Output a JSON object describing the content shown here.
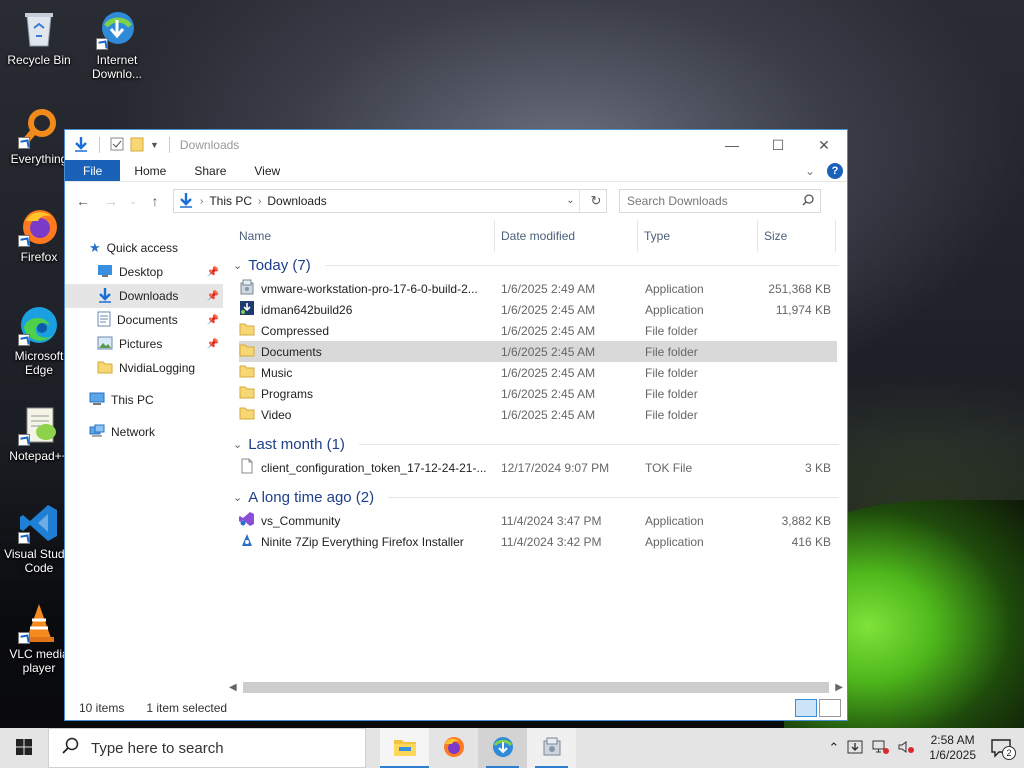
{
  "desktop": {
    "icons": [
      {
        "label": "Recycle Bin"
      },
      {
        "label": "Internet Downlo..."
      },
      {
        "label": "Everything"
      },
      {
        "label": "Firefox"
      },
      {
        "label": "Microsoft Edge"
      },
      {
        "label": "Notepad++"
      },
      {
        "label": "Visual Studio Code"
      },
      {
        "label": "VLC media player"
      }
    ]
  },
  "window": {
    "title": "Downloads",
    "ribbon_tabs": [
      "File",
      "Home",
      "Share",
      "View"
    ],
    "help_label": "?",
    "address": {
      "crumbs": [
        "This PC",
        "Downloads"
      ]
    },
    "search_placeholder": "Search Downloads",
    "nav": [
      {
        "label": "Quick access"
      },
      {
        "label": "Desktop"
      },
      {
        "label": "Downloads"
      },
      {
        "label": "Documents"
      },
      {
        "label": "Pictures"
      },
      {
        "label": "NvidiaLogging"
      },
      {
        "label": "This PC"
      },
      {
        "label": "Network"
      }
    ],
    "columns": [
      "Name",
      "Date modified",
      "Type",
      "Size"
    ],
    "groups": [
      {
        "label": "Today (7)",
        "rows": [
          {
            "name": "vmware-workstation-pro-17-6-0-build-2...",
            "date": "1/6/2025 2:49 AM",
            "type": "Application",
            "size": "251,368 KB",
            "icon": "installer-icon"
          },
          {
            "name": "idman642build26",
            "date": "1/6/2025 2:45 AM",
            "type": "Application",
            "size": "11,974 KB",
            "icon": "idm-app-icon"
          },
          {
            "name": "Compressed",
            "date": "1/6/2025 2:45 AM",
            "type": "File folder",
            "size": "",
            "icon": "folder-icon"
          },
          {
            "name": "Documents",
            "date": "1/6/2025 2:45 AM",
            "type": "File folder",
            "size": "",
            "icon": "folder-icon"
          },
          {
            "name": "Music",
            "date": "1/6/2025 2:45 AM",
            "type": "File folder",
            "size": "",
            "icon": "folder-icon"
          },
          {
            "name": "Programs",
            "date": "1/6/2025 2:45 AM",
            "type": "File folder",
            "size": "",
            "icon": "folder-icon"
          },
          {
            "name": "Video",
            "date": "1/6/2025 2:45 AM",
            "type": "File folder",
            "size": "",
            "icon": "folder-icon"
          }
        ]
      },
      {
        "label": "Last month (1)",
        "rows": [
          {
            "name": "client_configuration_token_17-12-24-21-...",
            "date": "12/17/2024 9:07 PM",
            "type": "TOK File",
            "size": "3 KB",
            "icon": "file-icon"
          }
        ]
      },
      {
        "label": "A long time ago (2)",
        "rows": [
          {
            "name": "vs_Community",
            "date": "11/4/2024 3:47 PM",
            "type": "Application",
            "size": "3,882 KB",
            "icon": "vs-installer-icon"
          },
          {
            "name": "Ninite 7Zip Everything Firefox Installer",
            "date": "11/4/2024 3:42 PM",
            "type": "Application",
            "size": "416 KB",
            "icon": "ninite-icon"
          }
        ]
      }
    ],
    "status": {
      "items": "10 items",
      "selected": "1 item selected"
    }
  },
  "taskbar": {
    "search_placeholder": "Type here to search",
    "time": "2:58 AM",
    "date": "1/6/2025",
    "notification_count": "2"
  }
}
